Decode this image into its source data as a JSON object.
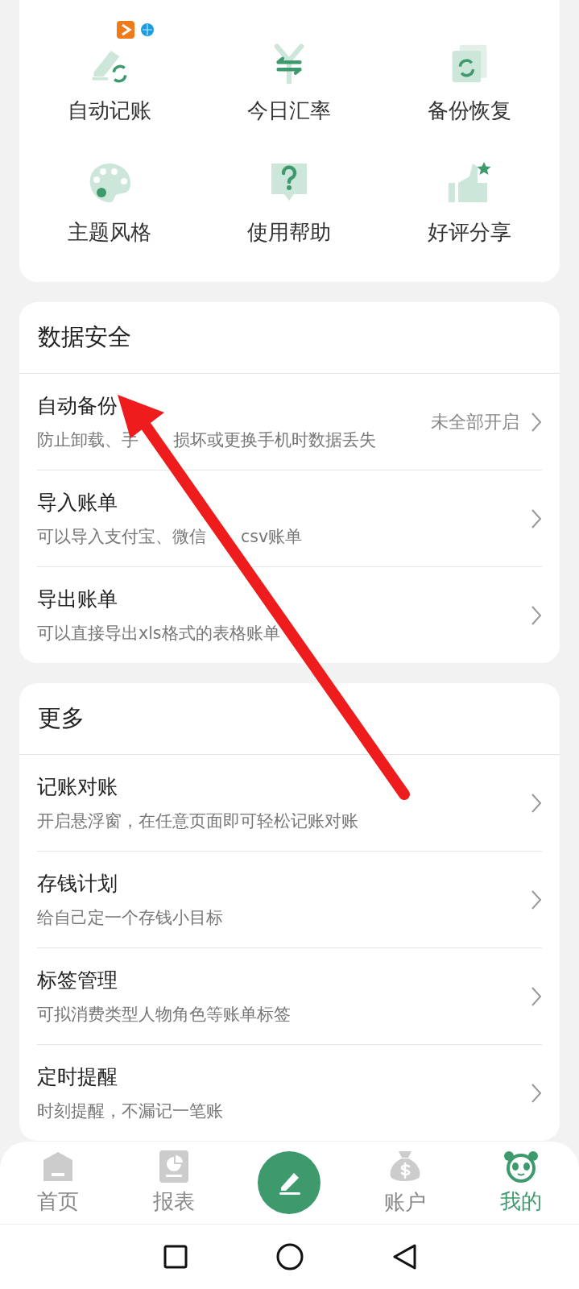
{
  "tools": [
    {
      "label": "自动记账",
      "kind": "auto"
    },
    {
      "label": "今日汇率",
      "kind": "rate"
    },
    {
      "label": "备份恢复",
      "kind": "backup"
    },
    {
      "label": "主题风格",
      "kind": "theme"
    },
    {
      "label": "使用帮助",
      "kind": "help"
    },
    {
      "label": "好评分享",
      "kind": "share"
    }
  ],
  "sections": [
    {
      "title": "数据安全",
      "rows": [
        {
          "title": "自动备份",
          "subtitle": [
            "防止卸载、手",
            "损坏或更换手机时数据丢失"
          ],
          "status": "未全部开启"
        },
        {
          "title": "导入账单",
          "subtitle": [
            "可以导入支付宝、微信",
            "csv账单"
          ]
        },
        {
          "title": "导出账单",
          "subtitle": "可以直接导出xls格式的表格账单"
        }
      ]
    },
    {
      "title": "更多",
      "rows": [
        {
          "title": "记账对账",
          "subtitle": "开启悬浮窗，在任意页面即可轻松记账对账"
        },
        {
          "title": "存钱计划",
          "subtitle": "给自己定一个存钱小目标"
        },
        {
          "title": "标签管理",
          "subtitle": "可拟消费类型人物角色等账单标签"
        },
        {
          "title": "定时提醒",
          "subtitle": "时刻提醒，不漏记一笔账"
        }
      ]
    }
  ],
  "bottom_nav": [
    {
      "kind": "home",
      "label": "首页",
      "selected": false
    },
    {
      "kind": "report",
      "label": "报表",
      "selected": false
    },
    {
      "kind": "compose"
    },
    {
      "kind": "account",
      "label": "账户",
      "selected": false
    },
    {
      "kind": "me",
      "label": "我的",
      "selected": true
    }
  ]
}
